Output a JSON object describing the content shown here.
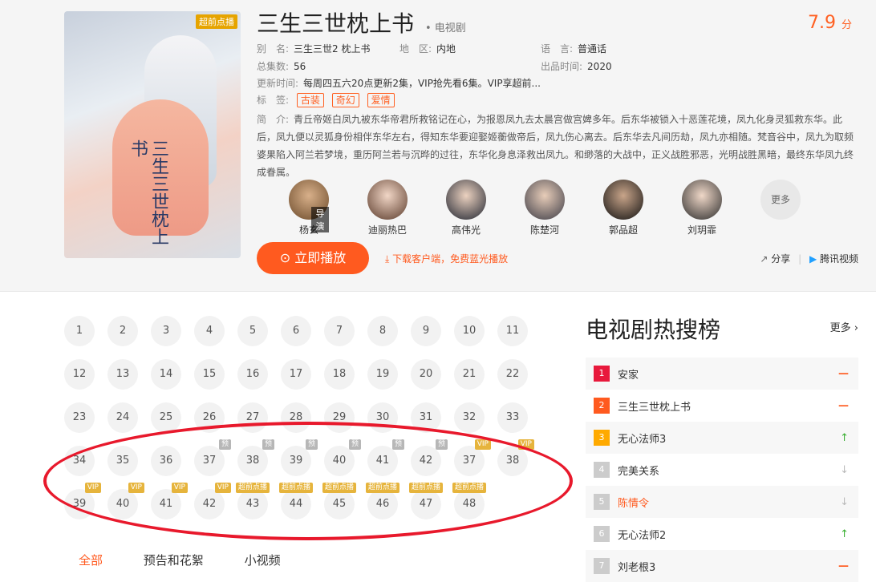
{
  "poster_badge": "超前点播",
  "calligraphy": "三生三世枕上书",
  "title": "三生三世枕上书",
  "type": "• 电视剧",
  "score": "7.9",
  "score_unit": "分",
  "meta": {
    "alias_k": "别　名:",
    "alias_v": "三生三世2 枕上书",
    "region_k": "地　区:",
    "region_v": "内地",
    "lang_k": "语　言:",
    "lang_v": "普通话",
    "eps_k": "总集数:",
    "eps_v": "56",
    "year_k": "出品时间:",
    "year_v": "2020",
    "update_k": "更新时间:",
    "update_v": "每周四五六20点更新2集，VIP抢先看6集。VIP享超前...",
    "tags_k": "标　签:"
  },
  "tags": [
    "古装",
    "奇幻",
    "爱情"
  ],
  "desc_k": "简　介:",
  "desc": "青丘帝姬白凤九被东华帝君所救铭记在心，为报恩凤九去太晨宫做宫婢多年。后东华被锁入十恶莲花境，凤九化身灵狐救东华。此后，凤九便以灵狐身份相伴东华左右，得知东华要迎娶姬蘅做帝后，凤九伤心离去。后东华去凡间历劫，凤九亦相随。梵音谷中，凤九为取频婆果陷入阿兰若梦境，重历阿兰若与沉晔的过往，东华化身息泽救出凤九。和缈落的大战中，正义战胜邪恶，光明战胜黑暗，最终东华凤九终成眷属。",
  "cast": [
    {
      "name": "杨玄",
      "tag": "导演"
    },
    {
      "name": "迪丽热巴"
    },
    {
      "name": "高伟光"
    },
    {
      "name": "陈楚河"
    },
    {
      "name": "郭品超"
    },
    {
      "name": "刘玥霏"
    }
  ],
  "cast_more": "更多",
  "play": "立即播放",
  "download": "下载客户端，免费蓝光播放",
  "share": "分享",
  "tencent": "腾讯视频",
  "episodes_rows": [
    [
      {
        "n": "1"
      },
      {
        "n": "2"
      },
      {
        "n": "3"
      },
      {
        "n": "4"
      },
      {
        "n": "5"
      },
      {
        "n": "6"
      },
      {
        "n": "7"
      },
      {
        "n": "8"
      },
      {
        "n": "9"
      },
      {
        "n": "10"
      },
      {
        "n": "11"
      }
    ],
    [
      {
        "n": "12"
      },
      {
        "n": "13"
      },
      {
        "n": "14"
      },
      {
        "n": "15"
      },
      {
        "n": "16"
      },
      {
        "n": "17"
      },
      {
        "n": "18"
      },
      {
        "n": "19"
      },
      {
        "n": "20"
      },
      {
        "n": "21"
      },
      {
        "n": "22"
      }
    ],
    [
      {
        "n": "23"
      },
      {
        "n": "24"
      },
      {
        "n": "25"
      },
      {
        "n": "26"
      },
      {
        "n": "27"
      },
      {
        "n": "28"
      },
      {
        "n": "29"
      },
      {
        "n": "30"
      },
      {
        "n": "31"
      },
      {
        "n": "32"
      },
      {
        "n": "33"
      }
    ],
    [
      {
        "n": "34"
      },
      {
        "n": "35"
      },
      {
        "n": "36"
      },
      {
        "n": "37",
        "m": "预"
      },
      {
        "n": "38",
        "m": "预"
      },
      {
        "n": "39",
        "m": "预"
      },
      {
        "n": "40",
        "m": "预"
      },
      {
        "n": "41",
        "m": "预"
      },
      {
        "n": "42",
        "m": "预"
      },
      {
        "n": "37",
        "m": "VIP"
      },
      {
        "n": "38",
        "m": "VIP"
      }
    ],
    [
      {
        "n": "39",
        "m": "VIP"
      },
      {
        "n": "40",
        "m": "VIP"
      },
      {
        "n": "41",
        "m": "VIP"
      },
      {
        "n": "42",
        "m": "VIP"
      },
      {
        "n": "43",
        "m": "超前点播"
      },
      {
        "n": "44",
        "m": "超前点播"
      },
      {
        "n": "45",
        "m": "超前点播"
      },
      {
        "n": "46",
        "m": "超前点播"
      },
      {
        "n": "47",
        "m": "超前点播"
      },
      {
        "n": "48",
        "m": "超前点播"
      }
    ]
  ],
  "tabs": [
    "全部",
    "预告和花絮",
    "小视频"
  ],
  "hot_title": "电视剧热搜榜",
  "hot_more": "更多 ›",
  "hot": [
    {
      "rank": "1",
      "name": "安家",
      "trend": "flat",
      "color": "#e8193c"
    },
    {
      "rank": "2",
      "name": "三生三世枕上书",
      "trend": "flat",
      "color": "#ff5a1f"
    },
    {
      "rank": "3",
      "name": "无心法师3",
      "trend": "up",
      "color": "#ffaa00"
    },
    {
      "rank": "4",
      "name": "完美关系",
      "trend": "down",
      "color": "#cccccc"
    },
    {
      "rank": "5",
      "name": "陈情令",
      "trend": "down",
      "color": "#cccccc",
      "highlight": true
    },
    {
      "rank": "6",
      "name": "无心法师2",
      "trend": "up",
      "color": "#cccccc"
    },
    {
      "rank": "7",
      "name": "刘老根3",
      "trend": "flat",
      "color": "#cccccc"
    }
  ]
}
